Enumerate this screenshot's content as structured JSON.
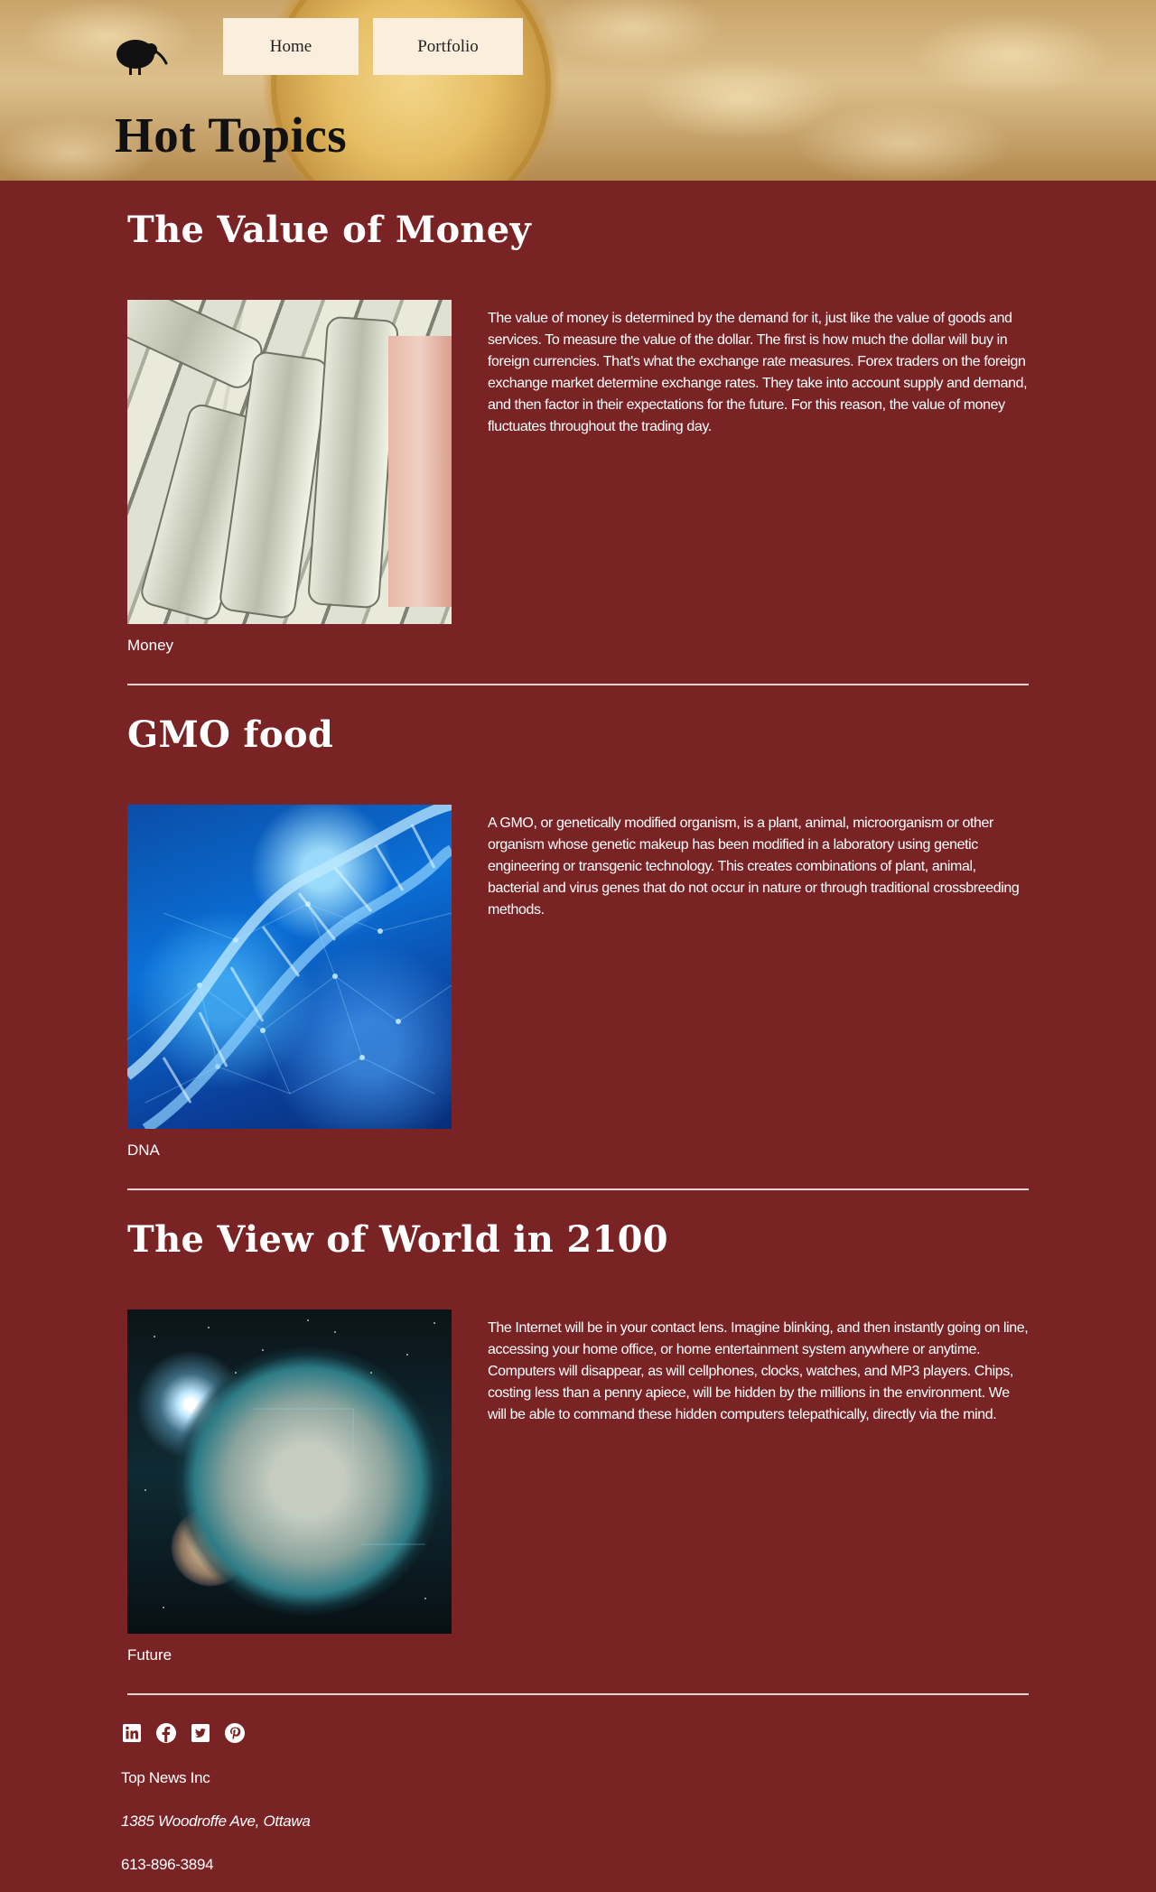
{
  "header": {
    "nav": [
      {
        "label": "Home"
      },
      {
        "label": "Portfolio"
      }
    ],
    "title": "Hot Topics"
  },
  "articles": [
    {
      "title": "The Value of Money",
      "text": "The value of money is determined by the demand for it, just like the value of goods and services. To measure the value of the dollar. The first is how much the dollar will buy in foreign currencies. That's what the exchange rate measures. Forex traders on the foreign exchange market determine exchange rates. They take into account supply and demand, and then factor in their expectations for the future. For this reason, the value of money fluctuates throughout the trading day.",
      "caption": "Money",
      "image_icon": "money-image"
    },
    {
      "title": "GMO food",
      "text": "A GMO, or genetically modified organism, is a plant, animal, microorganism or other organism whose genetic makeup has been modified in a laboratory using genetic engineering or transgenic technology. This creates combinations of plant, animal, bacterial and virus genes that do not occur in nature or through traditional crossbreeding methods.",
      "caption": "DNA",
      "image_icon": "dna-image"
    },
    {
      "title": "The View of World in 2100",
      "text": "The Internet will be in your contact lens. Imagine blinking, and then instantly going on line, accessing your home office, or home entertainment system anywhere or anytime. Computers will disappear, as will cellphones, clocks, watches, and MP3 players. Chips, costing less than a penny apiece, will be hidden by the millions in the environment. We will be able to command these hidden computers telepathically, directly via the mind.",
      "caption": "Future",
      "image_icon": "planets-image"
    }
  ],
  "footer": {
    "social": [
      "linkedin-icon",
      "facebook-icon",
      "twitter-icon",
      "pinterest-icon"
    ],
    "company": "Top News Inc",
    "address": "1385 Woodroffe Ave, Ottawa",
    "phone": "613-896-3894"
  },
  "colors": {
    "background": "#7a2325",
    "nav_button": "#fbeedc",
    "text": "#ffffff"
  }
}
